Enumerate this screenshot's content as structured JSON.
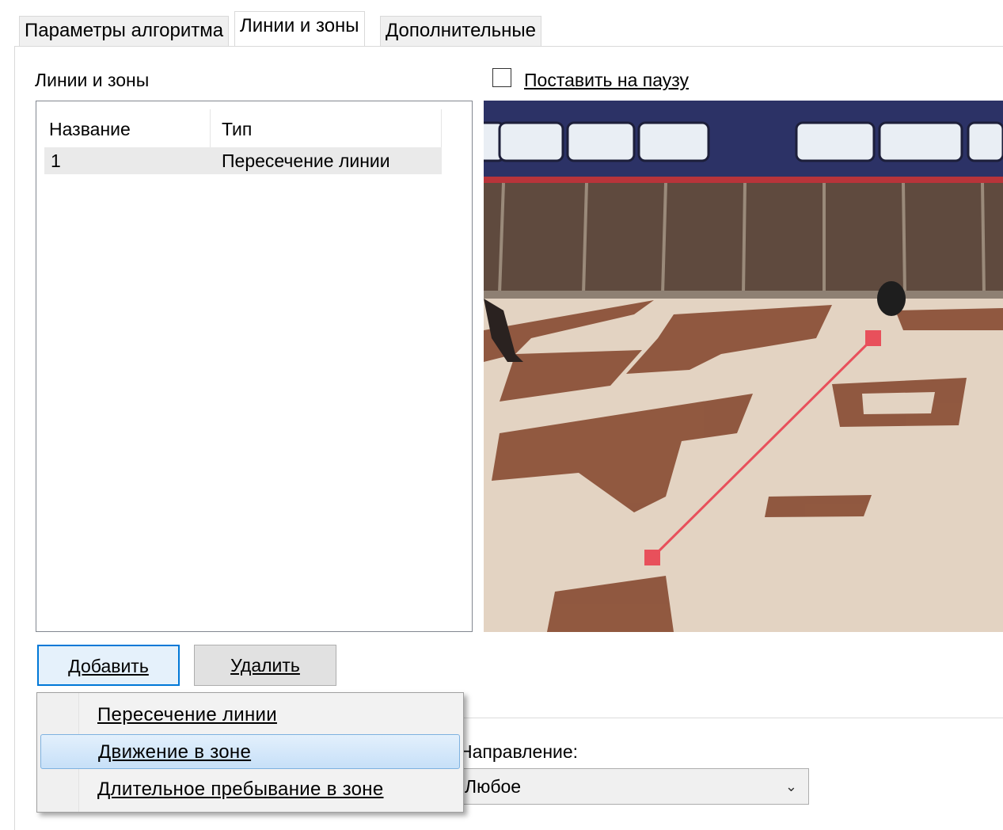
{
  "tabs": [
    {
      "label": "Параметры алгоритма",
      "active": false
    },
    {
      "label": "Линии и зоны",
      "active": true
    },
    {
      "label": "Дополнительные",
      "active": false
    }
  ],
  "lines_zones": {
    "label": "Линии и зоны",
    "columns": [
      "Название",
      "Тип"
    ],
    "rows": [
      {
        "name": "1",
        "type": "Пересечение линии"
      }
    ]
  },
  "pause": {
    "label": "Поставить на паузу",
    "checked": false
  },
  "buttons": {
    "add": "Добавить",
    "remove": "Удалить"
  },
  "context_menu": {
    "items": [
      "Пересечение линии",
      "Движение в зоне",
      "Длительное пребывание в зоне"
    ],
    "highlighted_index": 1
  },
  "direction": {
    "label": "Направление:",
    "value": "Любое"
  },
  "colors": {
    "accent": "#0078d7",
    "line": "#e8505b"
  }
}
